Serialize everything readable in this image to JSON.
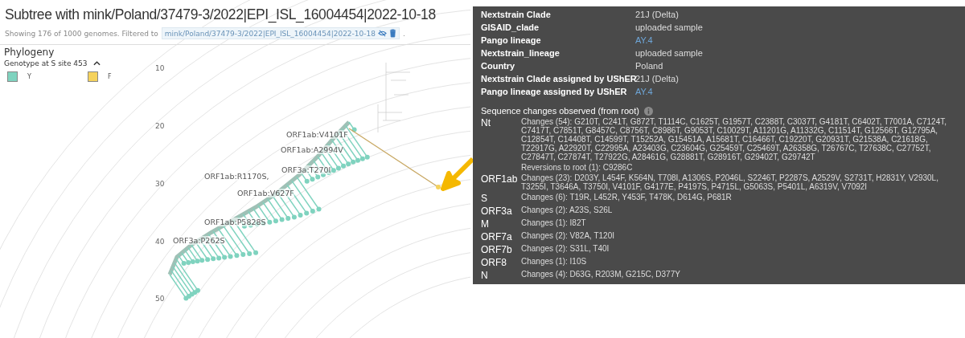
{
  "title": "Subtree with mink/Poland/37479-3/2022|EPI_ISL_16004454|2022-10-18",
  "summary": {
    "text": "Showing 176 of 1000 genomes. Filtered to",
    "filter": "mink/Poland/37479-3/2022|EPI_ISL_16004454|2022-10-18",
    "trailing": "."
  },
  "panel": {
    "title": "Phylogeny",
    "color_by": "Genotype at S site 453",
    "legend": [
      {
        "label": "Y",
        "color": "#7fd3bf"
      },
      {
        "label": "F",
        "color": "#f5d25c"
      }
    ]
  },
  "tree": {
    "axis_ticks": [
      "10",
      "20",
      "30",
      "40",
      "50"
    ],
    "branch_labels": [
      "ORF1ab:V4101F",
      "ORF1ab:A2994V",
      "ORF3a:T270I",
      "ORF1ab:R1170S,",
      "ORF1ab:V627F",
      "ORF1ab:P5828S",
      "ORF3a:P262S"
    ]
  },
  "tooltip": {
    "attributes": [
      {
        "label": "Nextstrain Clade",
        "value": "21J (Delta)",
        "kind": "text"
      },
      {
        "label": "GISAID_clade",
        "value": "uploaded sample",
        "kind": "text"
      },
      {
        "label": "Pango lineage",
        "value": "AY.4",
        "kind": "link"
      },
      {
        "label": "Nextstrain_lineage",
        "value": "uploaded sample",
        "kind": "text"
      },
      {
        "label": "Country",
        "value": "Poland",
        "kind": "text"
      },
      {
        "label": "Nextstrain Clade assigned by UShER",
        "value": "21J (Delta)",
        "kind": "text"
      },
      {
        "label": "Pango lineage assigned by UShER",
        "value": "AY.4",
        "kind": "link"
      }
    ],
    "section_title": "Sequence changes observed (from root)",
    "genes": [
      {
        "gene": "Nt",
        "changes": "Changes (54):  G210T, C241T, G872T, T1114C, C1625T, G1957T, C2388T, C3037T, G4181T, C6402T, T7001A, C7124T, C7417T, C7851T, G8457C, C8756T, C8986T, G9053T, C10029T, A11201G, A11332G, C11514T, G12566T, G12795A, C12854T, C14408T, C14599T, T15252A, G15451A, A15681T, C16466T, C19220T, G20931T, G21538A, C21618G, T22917G, A22920T, C22995A, A23403G, C23604G, G25459T, C25469T, A26358G, T26767C, T27638C, C27752T, C27847T, C27874T, T27922G, A28461G, G28881T, G28916T, G29402T, G29742T",
        "reversions": "Reversions to root (1):  C9286C"
      },
      {
        "gene": "ORF1ab",
        "changes": "Changes (23):  D203Y, L454F, K564N, T708I, A1306S, P2046L, S2246T, P2287S, A2529V, S2731T, H2831Y, V2930L, T3255I, T3646A, T3750I, V4101F, G4177E, P4197S, P4715L, G5063S, P5401L, A6319V, V7092I"
      },
      {
        "gene": "S",
        "changes": "Changes (6):  T19R, L452R, Y453F, T478K, D614G, P681R"
      },
      {
        "gene": "ORF3a",
        "changes": "Changes (2):  A23S, S26L"
      },
      {
        "gene": "M",
        "changes": "Changes (1):  I82T"
      },
      {
        "gene": "ORF7a",
        "changes": "Changes (2):  V82A, T120I"
      },
      {
        "gene": "ORF7b",
        "changes": "Changes (2):  S31L, T40I"
      },
      {
        "gene": "ORF8",
        "changes": "Changes (1):  I10S"
      },
      {
        "gene": "N",
        "changes": "Changes (4):  D63G, R203M, G215C, D377Y"
      }
    ]
  }
}
